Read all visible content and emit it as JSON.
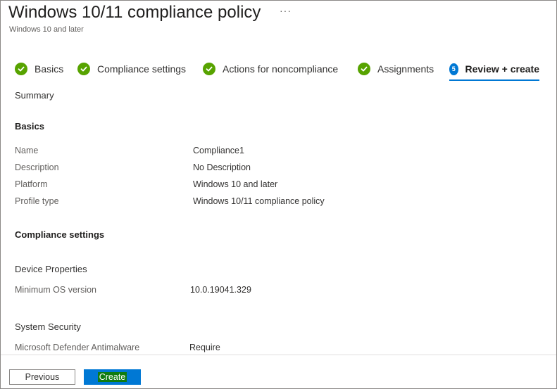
{
  "header": {
    "title": "Windows 10/11 compliance policy",
    "more": "···",
    "subtitle": "Windows 10 and later"
  },
  "tabs": [
    {
      "label": "Basics",
      "state": "complete"
    },
    {
      "label": "Compliance settings",
      "state": "complete"
    },
    {
      "label": "Actions for noncompliance",
      "state": "complete"
    },
    {
      "label": "Assignments",
      "state": "complete"
    },
    {
      "label": "Review + create",
      "state": "active",
      "step": "5"
    }
  ],
  "summary": {
    "heading": "Summary",
    "basics": {
      "heading": "Basics",
      "rows": [
        {
          "label": "Name",
          "value": "Compliance1"
        },
        {
          "label": "Description",
          "value": "No Description"
        },
        {
          "label": "Platform",
          "value": "Windows 10 and later"
        },
        {
          "label": "Profile type",
          "value": "Windows 10/11 compliance policy"
        }
      ]
    },
    "compliance": {
      "heading": "Compliance settings",
      "device_properties": {
        "heading": "Device Properties",
        "rows": [
          {
            "label": "Minimum OS version",
            "value": "10.0.19041.329"
          }
        ]
      },
      "system_security": {
        "heading": "System Security",
        "rows": [
          {
            "label": "Microsoft Defender Antimalware",
            "value": "Require"
          }
        ]
      }
    }
  },
  "footer": {
    "previous_label": "Previous",
    "create_label": "Create"
  },
  "colors": {
    "accent": "#0078d4",
    "success": "#57a300",
    "create_highlight": "#107c10"
  }
}
